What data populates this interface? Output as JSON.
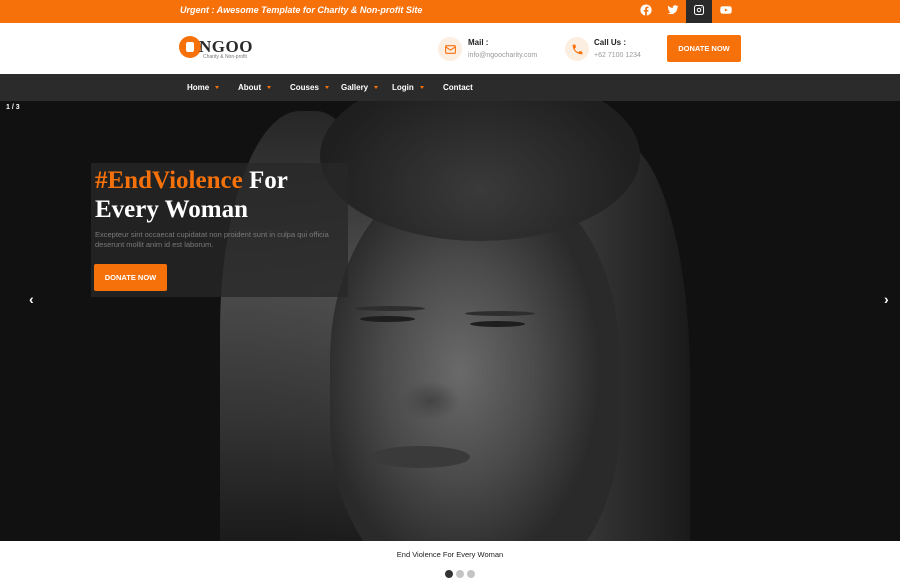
{
  "topbar": {
    "urgent_text": "Urgent : Awesome Template for Charity & Non-profit Site",
    "social": [
      "facebook-icon",
      "twitter-icon",
      "instagram-icon",
      "youtube-icon"
    ],
    "active_social": "instagram-icon"
  },
  "header": {
    "logo_text": "NGOO",
    "logo_tagline": "Charity & Non-profit",
    "mail_title": "Mail :",
    "mail_value": "info@ngoocharity.com",
    "call_title": "Call Us :",
    "call_value": "+62 7100 1234",
    "donate_label": "DONATE NOW"
  },
  "nav": {
    "items": [
      {
        "label": "Home",
        "dropdown": true
      },
      {
        "label": "About",
        "dropdown": true
      },
      {
        "label": "Couses",
        "dropdown": true
      },
      {
        "label": "Gallery",
        "dropdown": true
      },
      {
        "label": "Login",
        "dropdown": true
      },
      {
        "label": "Contact",
        "dropdown": false
      }
    ]
  },
  "hero": {
    "slide_counter": "1 / 3",
    "title_accent": "#EndViolence",
    "title_rest_line1": " For",
    "title_line2": "Every Woman",
    "description": "Excepteur sint occaecat cupidatat non proident sunt in culpa qui officia deserunt mollit anim id est laborum.",
    "donate_label": "DONATE NOW",
    "prev_arrow": "‹",
    "next_arrow": "›"
  },
  "caption": "End Violence For Every Woman",
  "dots": {
    "count": 3,
    "active": 1
  },
  "colors": {
    "accent": "#f7710b",
    "nav_bg": "#2b2b2b",
    "dark": "#2a2a2a"
  }
}
